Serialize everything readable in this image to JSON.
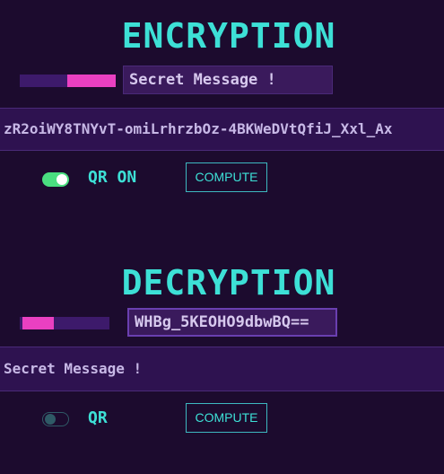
{
  "encryption": {
    "title": "ENCRYPTION",
    "slider_value": 0.55,
    "input_value": "Secret Message !",
    "output": "zR2oiWY8TNYvT-omiLrhrzbOz-4BKWeDVtQfiJ_Xxl_Ax",
    "qr_label": "QR ON",
    "qr_enabled": true,
    "compute_label": "COMPUTE"
  },
  "decryption": {
    "title": "DECRYPTION",
    "slider_value": 0.35,
    "input_value": "WHBg_5KEOHO9dbwBQ==",
    "output": "Secret Message !",
    "qr_label": "QR",
    "qr_enabled": false,
    "compute_label": "COMPUTE"
  },
  "colors": {
    "background": "#1c0b2e",
    "accent_cyan": "#3de0d6",
    "accent_pink": "#ea40c1",
    "toggle_on": "#4ade80",
    "panel": "#3a1a5c"
  }
}
